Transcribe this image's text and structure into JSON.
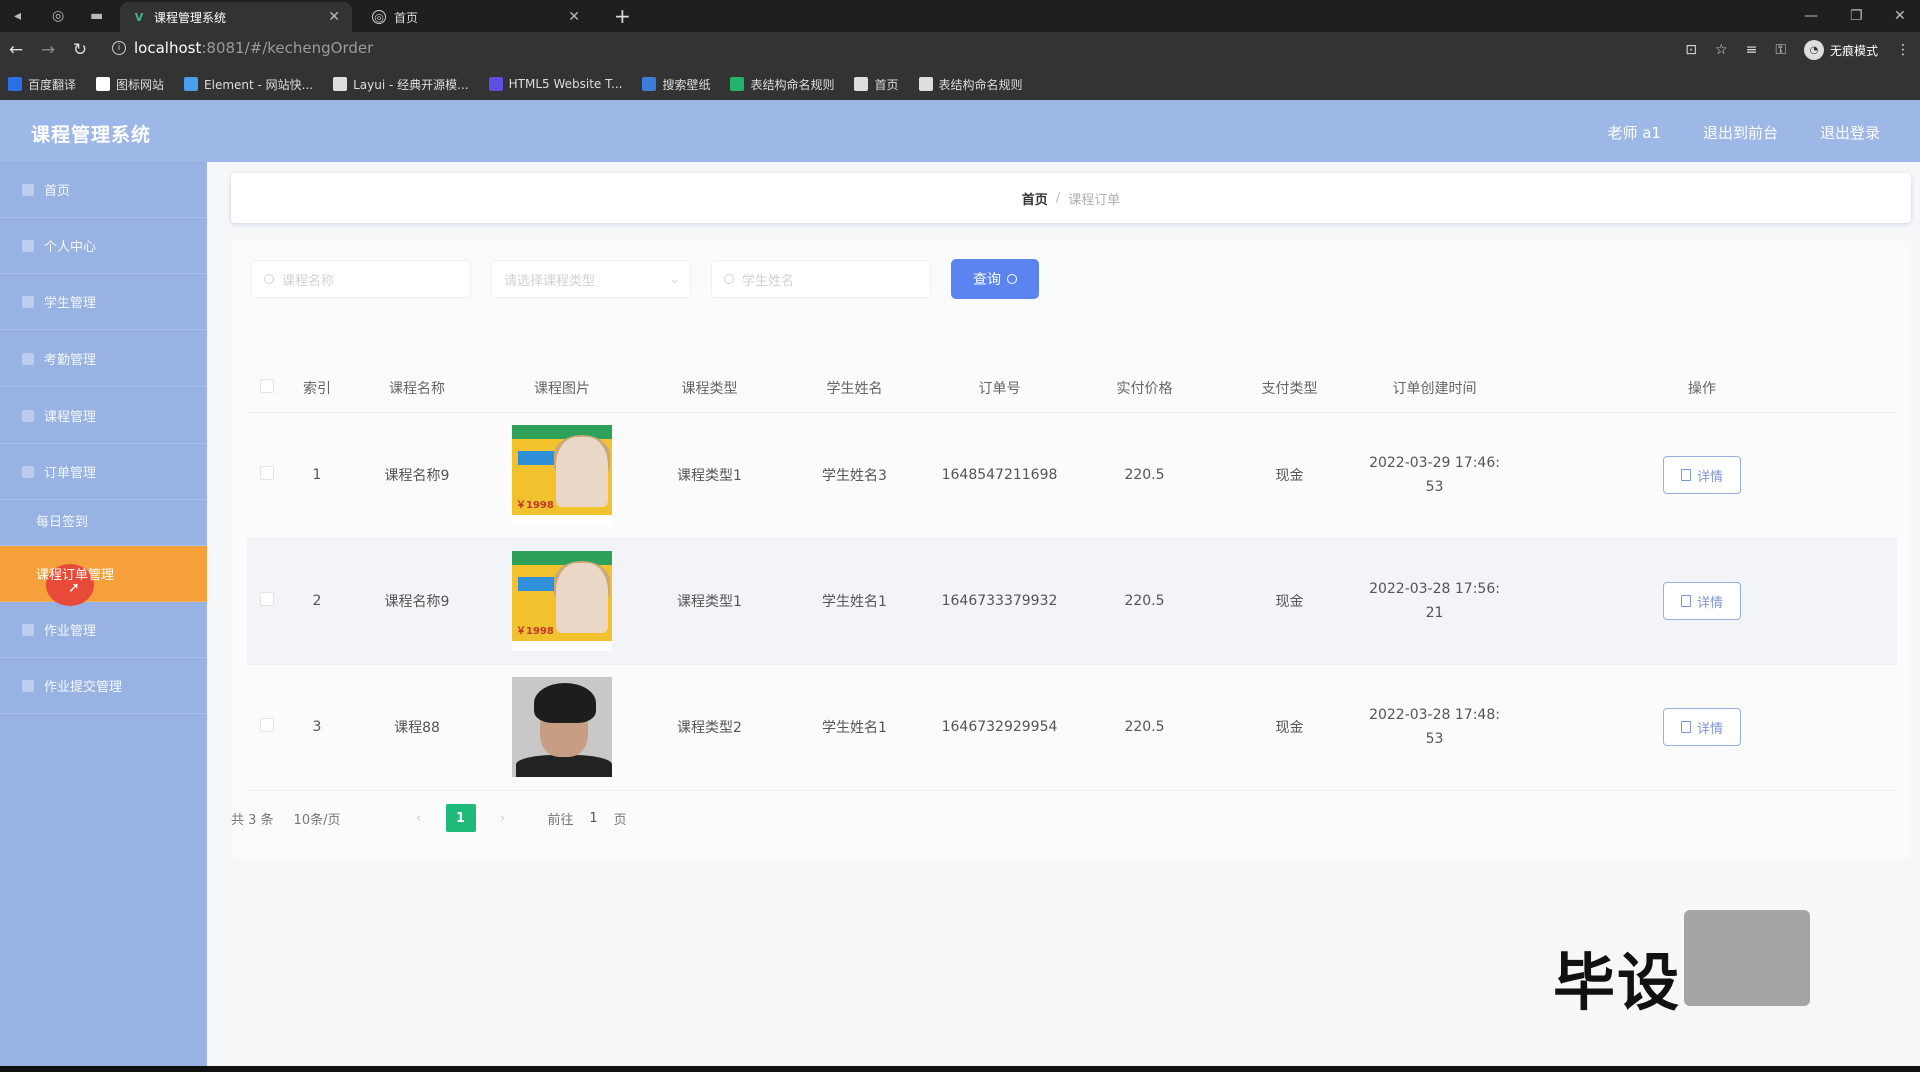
{
  "browser": {
    "tabs": [
      {
        "title": "课程管理系统",
        "icon": "vue-icon",
        "active": true
      },
      {
        "title": "首页",
        "icon": "globe-icon",
        "active": false
      }
    ],
    "url_host": "localhost",
    "url_path": ":8081/#/kechengOrder",
    "profile_label": "无痕模式",
    "bookmarks": [
      {
        "label": "百度翻译",
        "color": "#2a6ee8"
      },
      {
        "label": "图标网站",
        "color": "#ffffff"
      },
      {
        "label": "Element - 网站快...",
        "color": "#4aa0f0"
      },
      {
        "label": "Layui - 经典开源模...",
        "color": "#dddddd"
      },
      {
        "label": "HTML5 Website T...",
        "color": "#5a4fe0"
      },
      {
        "label": "搜索壁纸",
        "color": "#3d7bd9"
      },
      {
        "label": "表结构命名规则",
        "color": "#22b46e"
      },
      {
        "label": "首页",
        "color": "#dddddd"
      },
      {
        "label": "表结构命名规则",
        "color": "#dddddd"
      }
    ]
  },
  "app": {
    "title": "课程管理系统",
    "header_links": [
      "老师 a1",
      "退出到前台",
      "退出登录"
    ]
  },
  "sidebar": {
    "items": [
      {
        "label": "首页"
      },
      {
        "label": "个人中心"
      },
      {
        "label": "学生管理"
      },
      {
        "label": "考勤管理"
      },
      {
        "label": "课程管理"
      },
      {
        "label": "订单管理"
      },
      {
        "label": "每日签到"
      },
      {
        "label": "课程订单管理"
      },
      {
        "label": "作业管理"
      },
      {
        "label": "作业提交管理"
      }
    ]
  },
  "breadcrumb": {
    "home": "首页",
    "separator": "/",
    "current": "课程订单"
  },
  "search": {
    "course_name_placeholder": "课程名称",
    "course_type_placeholder": "请选择课程类型",
    "student_name_placeholder": "学生姓名",
    "query_label": "查询"
  },
  "table": {
    "headers": [
      "索引",
      "课程名称",
      "课程图片",
      "课程类型",
      "学生姓名",
      "订单号",
      "实付价格",
      "支付类型",
      "订单创建时间",
      "操作"
    ],
    "rows": [
      {
        "index": "1",
        "course_name": "课程名称9",
        "image": "promo",
        "course_type": "课程类型1",
        "student": "学生姓名3",
        "order_no": "1648547211698",
        "price": "220.5",
        "pay_type": "现金",
        "time_a": "2022-03-29 17:46:",
        "time_b": "53",
        "action": "详情"
      },
      {
        "index": "2",
        "course_name": "课程名称9",
        "image": "promo",
        "course_type": "课程类型1",
        "student": "学生姓名1",
        "order_no": "1646733379932",
        "price": "220.5",
        "pay_type": "现金",
        "time_a": "2022-03-28 17:56:",
        "time_b": "21",
        "action": "详情"
      },
      {
        "index": "3",
        "course_name": "课程88",
        "image": "person",
        "course_type": "课程类型2",
        "student": "学生姓名1",
        "order_no": "1646732929954",
        "price": "220.5",
        "pay_type": "现金",
        "time_a": "2022-03-28 17:48:",
        "time_b": "53",
        "action": "详情"
      }
    ]
  },
  "pagination": {
    "total": "共 3 条",
    "page_size": "10条/页",
    "current_page": "1",
    "goto_label": "前往",
    "goto_value": "1",
    "page_suffix": "页"
  },
  "promo_price": "￥1998",
  "watermark": "毕设",
  "colors": {
    "header": "#9db7e6",
    "sidebar": "#98b3e3",
    "active_menu": "#f5a03a",
    "query_button": "#5b84f0",
    "page_active": "#1fb97a"
  }
}
